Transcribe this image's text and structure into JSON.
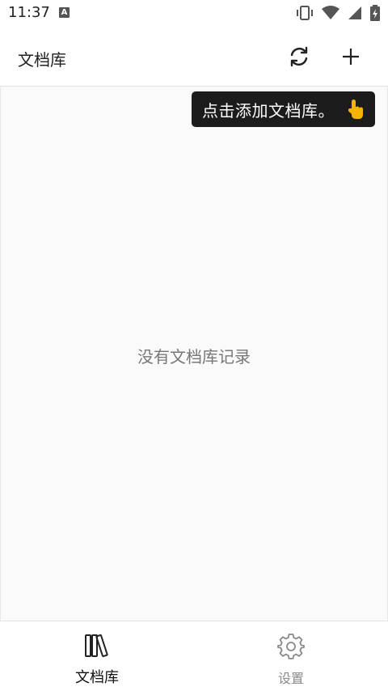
{
  "status_bar": {
    "time": "11:37",
    "badge": "A"
  },
  "app_bar": {
    "title": "文档库"
  },
  "tooltip": {
    "text": "点击添加文档库。",
    "emoji": "👆"
  },
  "empty_state": {
    "text": "没有文档库记录"
  },
  "bottom_nav": {
    "items": [
      {
        "label": "文档库",
        "icon": "library-books-icon",
        "active": true
      },
      {
        "label": "设置",
        "icon": "gear-icon",
        "active": false
      }
    ]
  },
  "colors": {
    "tooltip_bg": "#1c1c1c",
    "active_label": "#111111",
    "inactive_label": "#8a8a8a"
  }
}
